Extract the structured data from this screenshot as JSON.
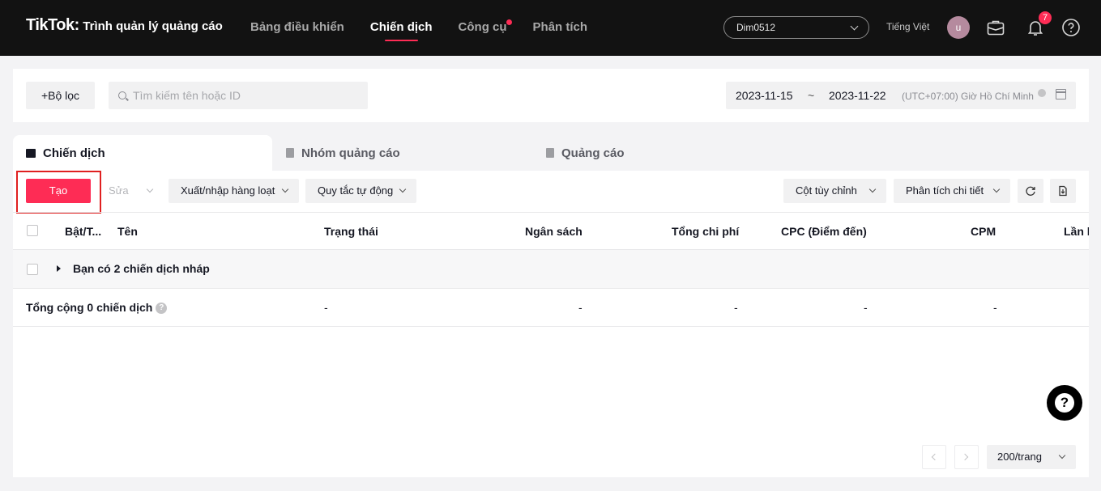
{
  "header": {
    "logo_word": "TikTok",
    "logo_colon": ":",
    "logo_subtitle": "Trình quản lý quảng cáo",
    "nav": [
      {
        "label": "Bảng điều khiển"
      },
      {
        "label": "Chiến dịch",
        "active": true
      },
      {
        "label": "Công cụ",
        "has_dot": true
      },
      {
        "label": "Phân tích"
      }
    ],
    "account": "Dim0512",
    "language": "Tiếng Việt",
    "avatar_initial": "u",
    "notification_count": "7",
    "icons": [
      "briefcase-icon",
      "bell-icon",
      "help-circle-icon"
    ]
  },
  "filterbar": {
    "filter_label": "Bộ lọc",
    "search_placeholder": "Tìm kiếm tên hoặc ID",
    "date_start": "2023-11-15",
    "date_separator": "~",
    "date_end": "2023-11-22",
    "timezone": "(UTC+07:00) Giờ Hồ Chí Minh"
  },
  "tabs": [
    {
      "label": "Chiến dịch",
      "active": true
    },
    {
      "label": "Nhóm quảng cáo"
    },
    {
      "label": "Quảng cáo"
    }
  ],
  "toolbar": {
    "create_label": "Tạo",
    "edit_label": "Sửa",
    "bulk_label": "Xuất/nhập hàng loạt",
    "rules_label": "Quy tắc tự động",
    "columns_label": "Cột tùy chỉnh",
    "breakdown_label": "Phân tích chi tiết"
  },
  "table": {
    "columns": [
      "Bật/T...",
      "Tên",
      "Trạng thái",
      "Ngân sách",
      "Tổng chi phí",
      "CPC (Điểm đến)",
      "CPM",
      "Lần h"
    ],
    "draft_row": "Bạn có 2 chiến dịch nháp",
    "total_label": "Tổng cộng 0 chiến dịch",
    "total_values": [
      "-",
      "-",
      "-",
      "-",
      "-"
    ]
  },
  "pagination": {
    "page_size": "200/trang"
  },
  "colors": {
    "accent": "#fe2c55",
    "topbar": "#121212",
    "highlight_border": "#e02020"
  }
}
